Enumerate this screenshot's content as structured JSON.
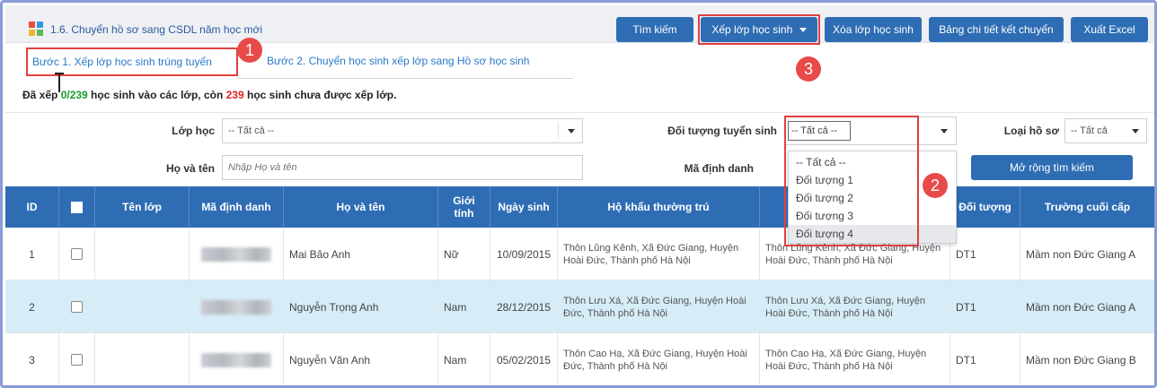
{
  "header": {
    "title": "1.6. Chuyển hồ sơ sang CSDL năm học mới",
    "buttons": {
      "search": "Tìm kiếm",
      "assign_class": "Xếp lớp học sinh",
      "delete_class": "Xóa lớp học sinh",
      "transfer_detail": "Bảng chi tiết kết chuyển",
      "export_excel": "Xuất Excel"
    }
  },
  "tabs": {
    "step1": "Bước 1. Xếp lớp học sinh trúng tuyển",
    "step2": "Bước 2. Chuyển học sinh xếp lớp sang Hồ sơ học sinh"
  },
  "summary": {
    "prefix": "Đã xếp ",
    "assigned": "0/239",
    "middle": " học sinh vào các lớp, còn ",
    "remaining": "239",
    "suffix": " học sinh chưa được xếp lớp."
  },
  "filters": {
    "class_label": "Lớp học",
    "class_value": "-- Tất cả --",
    "target_label": "Đối tượng tuyển sinh",
    "target_value": "-- Tất cả --",
    "record_type_label": "Loại hồ sơ",
    "record_type_value": "-- Tất cả",
    "name_label": "Họ và tên",
    "name_placeholder": "Nhập Họ và tên",
    "id_label": "Mã định danh",
    "expand_button": "Mở rộng tìm kiếm"
  },
  "dropdown": {
    "options": [
      "-- Tất cả --",
      "Đối tượng 1",
      "Đối tượng 2",
      "Đối tượng 3",
      "Đối tượng 4"
    ],
    "selected_index": 4
  },
  "table": {
    "headers": {
      "id": "ID",
      "class_name": "Tên lớp",
      "identifier": "Mã định danh",
      "full_name": "Họ và tên",
      "gender_line1": "Giới",
      "gender_line2": "tính",
      "dob": "Ngày sinh",
      "residence": "Hộ khẩu thường trú",
      "target": "Đối tượng",
      "last_school": "Trường cuối cấp"
    },
    "rows": [
      {
        "id": "1",
        "name": "Mai Bảo Anh",
        "gender": "Nữ",
        "dob": "10/09/2015",
        "residence": "Thôn Lũng Kênh, Xã Đức Giang, Huyện Hoài Đức, Thành phố Hà Nội",
        "address2": "Thôn Lũng Kênh, Xã Đức Giang, Huyện Hoài Đức, Thành phố Hà Nội",
        "target": "DT1",
        "school": "Mầm non Đức Giang A"
      },
      {
        "id": "2",
        "name": "Nguyễn Trọng Anh",
        "gender": "Nam",
        "dob": "28/12/2015",
        "residence": "Thôn Lưu Xá, Xã Đức Giang, Huyện Hoài Đức, Thành phố Hà Nội",
        "address2": "Thôn Lưu Xá, Xã Đức Giang, Huyện Hoài Đức, Thành phố Hà Nội",
        "target": "DT1",
        "school": "Mầm non Đức Giang A"
      },
      {
        "id": "3",
        "name": "Nguyễn Văn Anh",
        "gender": "Nam",
        "dob": "05/02/2015",
        "residence": "Thôn Cao Hạ, Xã Đức Giang, Huyện Hoài Đức, Thành phố Hà Nội",
        "address2": "Thôn Cao Hạ, Xã Đức Giang, Huyện Hoài Đức, Thành phố Hà Nội",
        "target": "DT1",
        "school": "Mầm non Đức Giang B"
      }
    ]
  },
  "callouts": [
    "1",
    "2",
    "3"
  ],
  "colors": {
    "primary": "#2e6db4",
    "highlight": "#e04040",
    "selected_row": "#d6ecf7"
  }
}
